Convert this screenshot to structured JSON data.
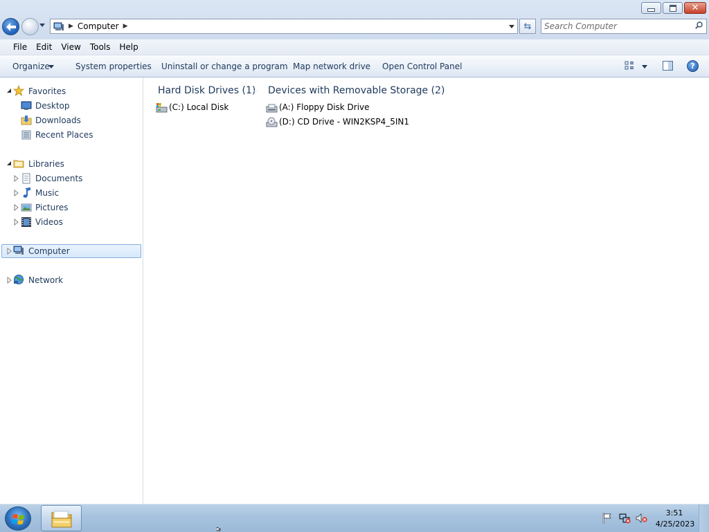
{
  "window": {
    "title_buttons": {
      "minimize": "minimize",
      "maximize": "restore",
      "close": "close"
    }
  },
  "nav": {
    "address": {
      "crumbs": [
        "Computer"
      ]
    },
    "search": {
      "placeholder": "Search Computer"
    }
  },
  "menu": {
    "items": [
      "File",
      "Edit",
      "View",
      "Tools",
      "Help"
    ]
  },
  "commands": {
    "organize": "Organize",
    "system_properties": "System properties",
    "uninstall": "Uninstall or change a program",
    "map_drive": "Map network drive",
    "control_panel": "Open Control Panel"
  },
  "sidebar": {
    "favorites": {
      "label": "Favorites",
      "items": [
        "Desktop",
        "Downloads",
        "Recent Places"
      ]
    },
    "libraries": {
      "label": "Libraries",
      "items": [
        "Documents",
        "Music",
        "Pictures",
        "Videos"
      ]
    },
    "computer": {
      "label": "Computer",
      "selected": true
    },
    "network": {
      "label": "Network"
    }
  },
  "content": {
    "groups": [
      {
        "header": "Hard Disk Drives (1)",
        "items": [
          {
            "label": "(C:) Local Disk",
            "icon": "hard-disk-icon"
          }
        ]
      },
      {
        "header": "Devices with Removable Storage (2)",
        "items": [
          {
            "label": "(A:) Floppy Disk Drive",
            "icon": "floppy-drive-icon"
          },
          {
            "label": "(D:) CD Drive - WIN2KSP4_5IN1",
            "icon": "cd-drive-icon"
          }
        ]
      }
    ]
  },
  "taskbar": {
    "clock": {
      "time": "3:51",
      "date": "4/25/2023"
    },
    "tray_icons": [
      "action-center-flag-icon",
      "network-icon",
      "volume-muted-icon"
    ]
  },
  "colors": {
    "accent": "#1e395b",
    "selection": "#d8e9fb",
    "taskbar": "#a6c2de"
  }
}
